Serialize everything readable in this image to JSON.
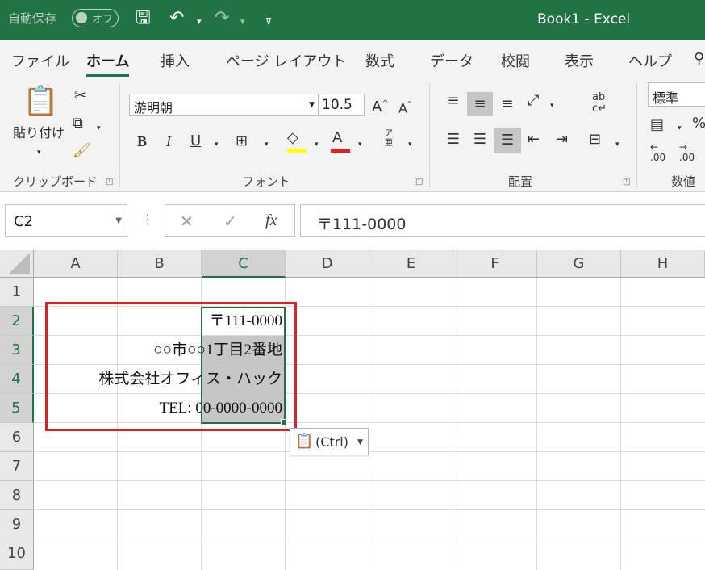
{
  "titlebar": {
    "autosave_label": "自動保存",
    "autosave_state": "オフ",
    "doc_title": "Book1  -  Excel",
    "icons": [
      "save-icon",
      "undo-icon",
      "redo-icon",
      "customize-quick-access-icon"
    ]
  },
  "tabs": [
    "ファイル",
    "ホーム",
    "挿入",
    "ページ レイアウト",
    "数式",
    "データ",
    "校閲",
    "表示",
    "ヘルプ"
  ],
  "active_tab": "ホーム",
  "ribbon": {
    "clipboard": {
      "paste_label": "貼り付け",
      "group_label": "クリップボード"
    },
    "font": {
      "font_name": "游明朝",
      "font_size": "10.5",
      "group_label": "フォント",
      "bold": "B",
      "italic": "I",
      "underline": "U",
      "grow": "A",
      "shrink": "A",
      "phonetic_top": "ア",
      "phonetic_bottom": "亜"
    },
    "alignment": {
      "group_label": "配置",
      "wrap_top": "ab",
      "wrap_bottom": "c"
    },
    "number": {
      "format": "標準",
      "group_label": "数値",
      "percent": "%",
      "inc_decimal": ".00",
      "dec_decimal": ".00"
    },
    "accent_fill": "#ffff00",
    "accent_font": "#e01f1f"
  },
  "formula_bar": {
    "name_box": "C2",
    "cancel": "✕",
    "enter": "✓",
    "fx": "fx",
    "formula": "〒111-0000"
  },
  "columns": [
    "A",
    "B",
    "C",
    "D",
    "E",
    "F",
    "G",
    "H"
  ],
  "rows": [
    "1",
    "2",
    "3",
    "4",
    "5",
    "6",
    "7",
    "8",
    "9",
    "10"
  ],
  "cells": {
    "C2": "〒111-0000",
    "B3": "○○市○○1丁目2番地",
    "A4": "株式会社オフィス・ハック",
    "B5": "TEL: 00-0000-0000"
  },
  "paste_options": {
    "label": "(Ctrl)"
  },
  "colors": {
    "excel_green": "#217346",
    "highlight_red": "#e01f1f"
  }
}
